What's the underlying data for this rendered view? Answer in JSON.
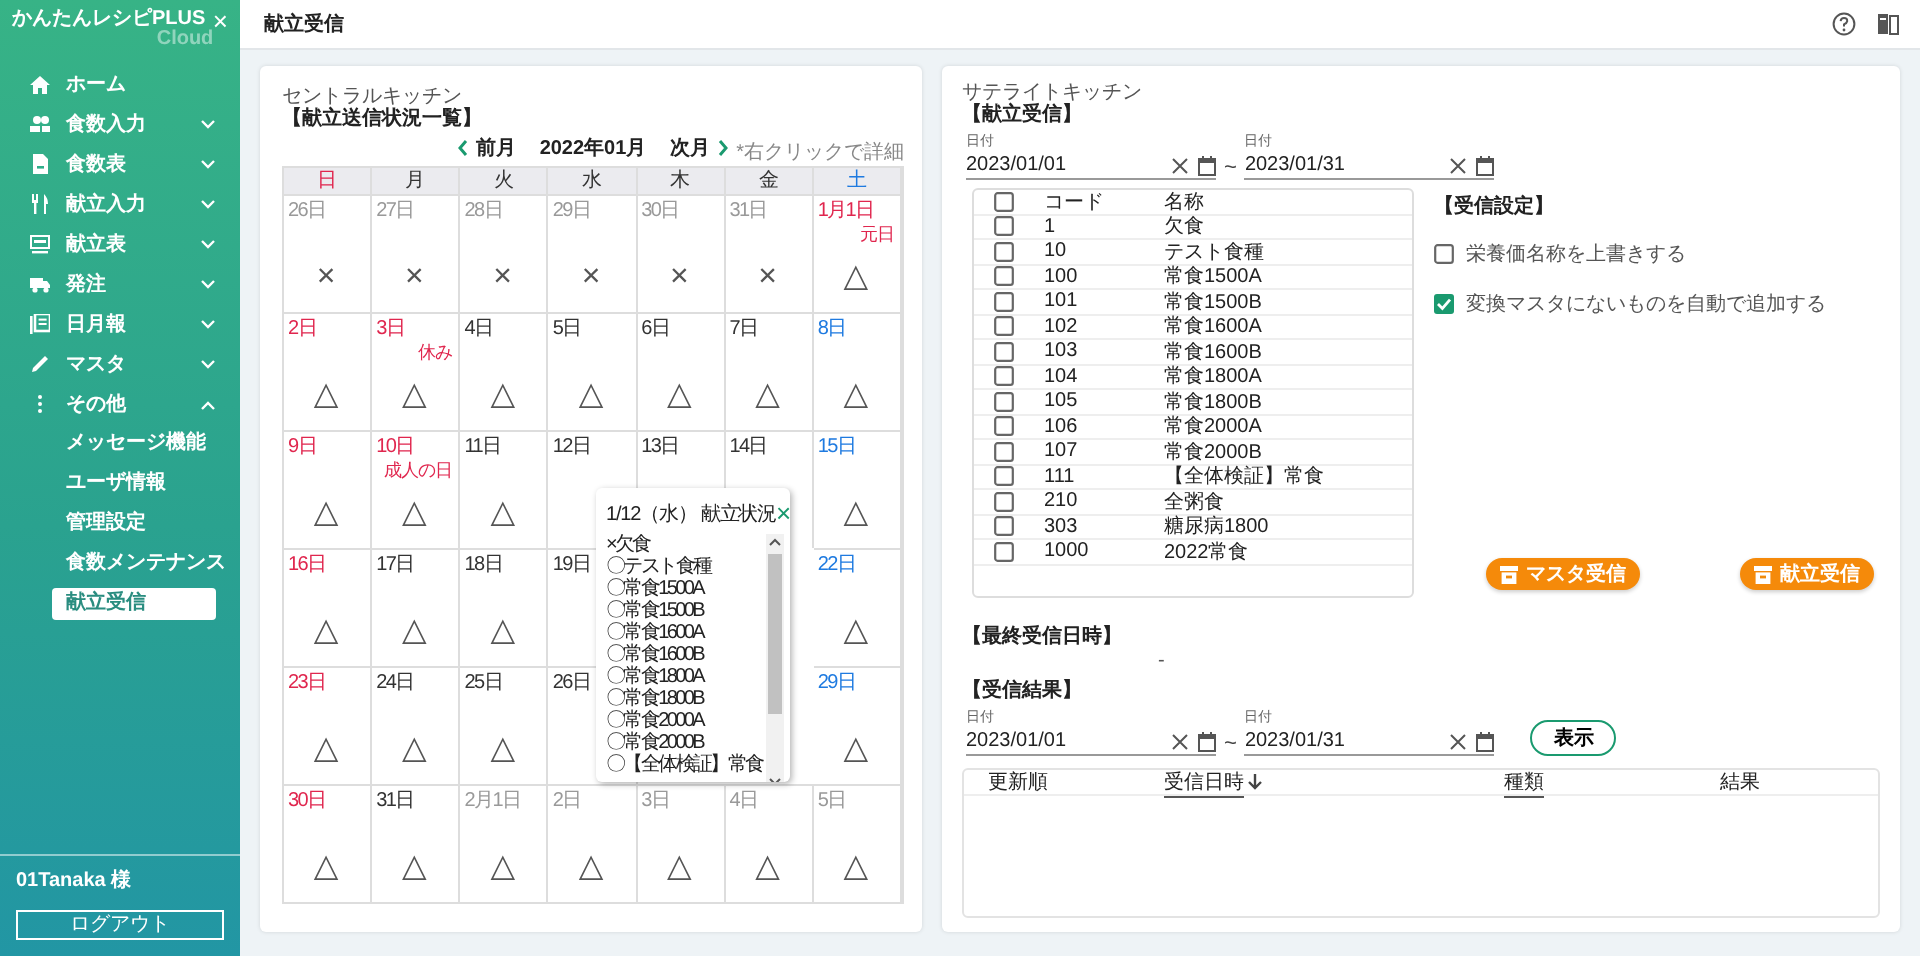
{
  "sidebar": {
    "logo": "かんたんレシピPLUS",
    "logo_sub": "Cloud",
    "close": "×",
    "items": [
      {
        "label": "ホーム",
        "kind": "link"
      },
      {
        "label": "食数入力",
        "kind": "group",
        "expanded": false
      },
      {
        "label": "食数表",
        "kind": "group",
        "expanded": false
      },
      {
        "label": "献立入力",
        "kind": "group",
        "expanded": false
      },
      {
        "label": "献立表",
        "kind": "group",
        "expanded": false
      },
      {
        "label": "発注",
        "kind": "group",
        "expanded": false
      },
      {
        "label": "日月報",
        "kind": "group",
        "expanded": false
      },
      {
        "label": "マスタ",
        "kind": "group",
        "expanded": false
      },
      {
        "label": "その他",
        "kind": "group",
        "expanded": true,
        "children": [
          {
            "label": "メッセージ機能",
            "selected": false
          },
          {
            "label": "ユーザ情報",
            "selected": false
          },
          {
            "label": "管理設定",
            "selected": false
          },
          {
            "label": "食数メンテナンス",
            "selected": false
          },
          {
            "label": "献立受信",
            "selected": true
          }
        ]
      }
    ],
    "user": "01Tanaka 様",
    "logout": "ログアウト"
  },
  "page_title": "献立受信",
  "central": {
    "title": "セントラルキッチン",
    "section": "【献立送信状況一覧】",
    "prev": "前月",
    "month": "2022年01月",
    "next": "次月",
    "hint": "*右クリックで詳細",
    "weekdays": [
      {
        "label": "日",
        "kind": "sun"
      },
      {
        "label": "月",
        "kind": "normal"
      },
      {
        "label": "火",
        "kind": "normal"
      },
      {
        "label": "水",
        "kind": "normal"
      },
      {
        "label": "木",
        "kind": "normal"
      },
      {
        "label": "金",
        "kind": "normal"
      },
      {
        "label": "土",
        "kind": "sat"
      }
    ],
    "weeks": [
      [
        {
          "date": "26日",
          "kind": "other",
          "mark": "×"
        },
        {
          "date": "27日",
          "kind": "other",
          "mark": "×"
        },
        {
          "date": "28日",
          "kind": "other",
          "mark": "×"
        },
        {
          "date": "29日",
          "kind": "other",
          "mark": "×"
        },
        {
          "date": "30日",
          "kind": "other",
          "mark": "×"
        },
        {
          "date": "31日",
          "kind": "other",
          "mark": "×"
        },
        {
          "date": "1月1日",
          "kind": "holiday",
          "note": "元日",
          "mark": "△"
        }
      ],
      [
        {
          "date": "2日",
          "kind": "sun",
          "mark": "△"
        },
        {
          "date": "3日",
          "kind": "holiday",
          "note": "休み",
          "mark": "△"
        },
        {
          "date": "4日",
          "kind": "normal",
          "mark": "△"
        },
        {
          "date": "5日",
          "kind": "normal",
          "mark": "△"
        },
        {
          "date": "6日",
          "kind": "normal",
          "mark": "△"
        },
        {
          "date": "7日",
          "kind": "normal",
          "mark": "△"
        },
        {
          "date": "8日",
          "kind": "sat",
          "mark": "△"
        }
      ],
      [
        {
          "date": "9日",
          "kind": "sun",
          "mark": "△"
        },
        {
          "date": "10日",
          "kind": "holiday",
          "note": "成人の日",
          "mark": "△"
        },
        {
          "date": "11日",
          "kind": "normal",
          "mark": "△"
        },
        {
          "date": "12日",
          "kind": "normal"
        },
        {
          "date": "13日",
          "kind": "normal"
        },
        {
          "date": "14日",
          "kind": "normal"
        },
        {
          "date": "15日",
          "kind": "sat",
          "mark": "△"
        }
      ],
      [
        {
          "date": "16日",
          "kind": "sun",
          "mark": "△"
        },
        {
          "date": "17日",
          "kind": "normal",
          "mark": "△"
        },
        {
          "date": "18日",
          "kind": "normal",
          "mark": "△"
        },
        {
          "date": "19日",
          "kind": "normal"
        },
        {
          "covered": true
        },
        {
          "covered": true
        },
        {
          "date": "22日",
          "kind": "sat",
          "mark": "△"
        }
      ],
      [
        {
          "date": "23日",
          "kind": "sun",
          "mark": "△"
        },
        {
          "date": "24日",
          "kind": "normal",
          "mark": "△"
        },
        {
          "date": "25日",
          "kind": "normal",
          "mark": "△"
        },
        {
          "date": "26日",
          "kind": "normal"
        },
        {
          "covered": true
        },
        {
          "covered": true
        },
        {
          "date": "29日",
          "kind": "sat",
          "mark": "△"
        }
      ],
      [
        {
          "date": "30日",
          "kind": "sun",
          "mark": "△"
        },
        {
          "date": "31日",
          "kind": "normal",
          "mark": "△"
        },
        {
          "date": "2月1日",
          "kind": "other",
          "mark": "△"
        },
        {
          "date": "2日",
          "kind": "other",
          "mark": "△"
        },
        {
          "date": "3日",
          "kind": "other",
          "mark": "△"
        },
        {
          "date": "4日",
          "kind": "other",
          "mark": "△"
        },
        {
          "date": "5日",
          "kind": "other",
          "mark": "△"
        }
      ]
    ],
    "popup": {
      "title": "1/12（水） 献立状況",
      "close": "×",
      "items": [
        "×欠食",
        "〇テスト食種",
        "〇常食1500A",
        "〇常食1500B",
        "〇常食1600A",
        "〇常食1600B",
        "〇常食1800A",
        "〇常食1800B",
        "〇常食2000A",
        "〇常食2000B",
        "〇【全体検証】常食"
      ]
    }
  },
  "satellite": {
    "title": "サテライトキッチン",
    "receive_section": "【献立受信】",
    "range": {
      "from_label": "日付",
      "from": "2023/01/01",
      "tilde": "~",
      "to_label": "日付",
      "to": "2023/01/31"
    },
    "table": {
      "all_checked": false,
      "columns": [
        "コード",
        "名称"
      ],
      "rows": [
        {
          "code": "1",
          "name": "欠食",
          "checked": false
        },
        {
          "code": "10",
          "name": "テスト食種",
          "checked": false
        },
        {
          "code": "100",
          "name": "常食1500A",
          "checked": false
        },
        {
          "code": "101",
          "name": "常食1500B",
          "checked": false
        },
        {
          "code": "102",
          "name": "常食1600A",
          "checked": false
        },
        {
          "code": "103",
          "name": "常食1600B",
          "checked": false
        },
        {
          "code": "104",
          "name": "常食1800A",
          "checked": false
        },
        {
          "code": "105",
          "name": "常食1800B",
          "checked": false
        },
        {
          "code": "106",
          "name": "常食2000A",
          "checked": false
        },
        {
          "code": "107",
          "name": "常食2000B",
          "checked": false
        },
        {
          "code": "111",
          "name": "【全体検証】常食",
          "checked": false
        },
        {
          "code": "210",
          "name": "全粥食",
          "checked": false
        },
        {
          "code": "303",
          "name": "糖尿病1800",
          "checked": false
        },
        {
          "code": "1000",
          "name": "2022常食",
          "checked": false
        }
      ]
    },
    "settings_title": "【受信設定】",
    "settings": [
      {
        "label": "栄養価名称を上書きする",
        "checked": false
      },
      {
        "label": "変換マスタにないものを自動で追加する",
        "checked": true
      }
    ],
    "buttons": [
      "マスタ受信",
      "献立受信"
    ],
    "last_title": "【最終受信日時】",
    "last_value": "-",
    "result_title": "【受信結果】",
    "result_range": {
      "from_label": "日付",
      "from": "2023/01/01",
      "tilde": "~",
      "to_label": "日付",
      "to": "2023/01/31"
    },
    "show_button": "表示",
    "result_columns": [
      {
        "label": "更新順",
        "sortable": false,
        "sorted": false
      },
      {
        "label": "受信日時",
        "sortable": true,
        "sorted": true
      },
      {
        "label": "種類",
        "sortable": true,
        "sorted": false
      },
      {
        "label": "結果",
        "sortable": false,
        "sorted": false
      }
    ]
  }
}
